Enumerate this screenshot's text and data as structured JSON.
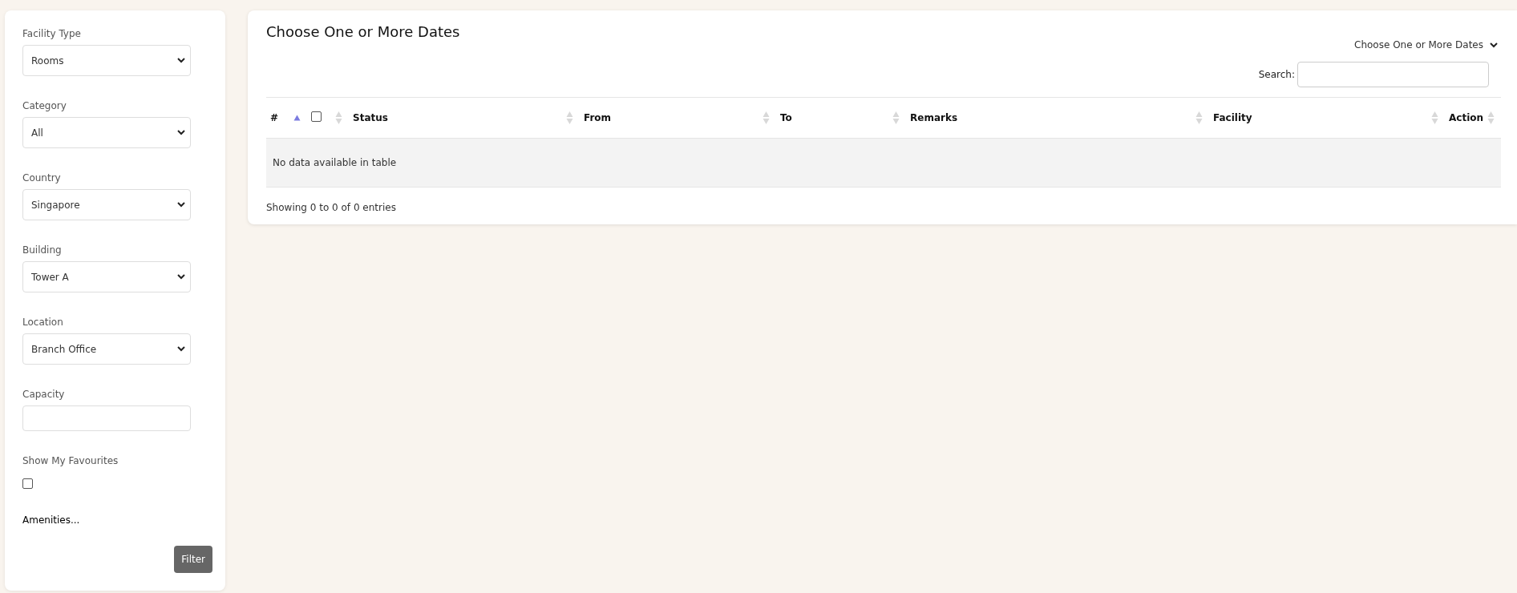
{
  "filters": [
    {
      "kind": "select",
      "label": "Facility Type",
      "value": "Rooms"
    },
    {
      "kind": "select",
      "label": "Category",
      "value": "All"
    },
    {
      "kind": "select",
      "label": "Country",
      "value": "Singapore"
    },
    {
      "kind": "select",
      "label": "Building",
      "value": "Tower A"
    },
    {
      "kind": "select",
      "label": "Location",
      "value": "Branch Office"
    },
    {
      "kind": "text",
      "label": "Capacity"
    },
    {
      "kind": "checkbox",
      "label": "Show My Favourites",
      "checked": false
    }
  ],
  "amenities_link": "Amenities...",
  "filter_button": "Filter",
  "main": {
    "title": "Choose One or More Dates",
    "dropdown": "Choose One or More Dates",
    "search_label": "Search:",
    "table": {
      "columns": [
        {
          "kind": "text",
          "label": "#",
          "sorted": true
        },
        {
          "kind": "checkbox",
          "checked": false,
          "sorted": false
        },
        {
          "kind": "text",
          "label": "Status",
          "sorted": false
        },
        {
          "kind": "text",
          "label": "From",
          "sorted": false
        },
        {
          "kind": "text",
          "label": "To",
          "sorted": false
        },
        {
          "kind": "text",
          "label": "Remarks",
          "sorted": false
        },
        {
          "kind": "text",
          "label": "Facility",
          "sorted": false
        },
        {
          "kind": "text",
          "label": "Action",
          "sorted": false
        }
      ],
      "empty_message": "No data available in table"
    },
    "info": "Showing 0 to 0 of 0 entries"
  }
}
